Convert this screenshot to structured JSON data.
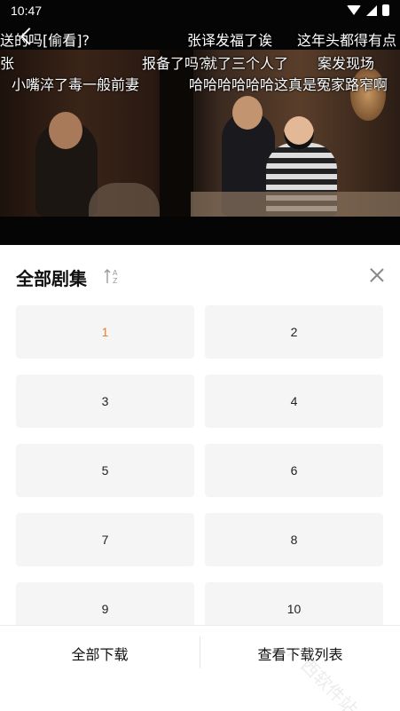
{
  "status_bar": {
    "time": "10:47"
  },
  "danmaku": [
    "送的吗[偷看]?",
    "张译发福了诶",
    "这年头都得有点",
    "张",
    "报备了吗？",
    "就了三个人了",
    "案发现场",
    "小嘴淬了毒一般前妻",
    "哈哈哈哈哈哈这真是冤家路窄啊"
  ],
  "panel": {
    "title": "全部剧集",
    "sort_icon": "sort-az-icon",
    "close_icon": "close-icon",
    "active_episode": "1",
    "active_color": "#e87d2e",
    "episodes": [
      "1",
      "2",
      "3",
      "4",
      "5",
      "6",
      "7",
      "8",
      "9",
      "10"
    ]
  },
  "bottom_bar": {
    "download_all": "全部下载",
    "view_download_list": "查看下载列表"
  },
  "watermark": "广西软件站"
}
